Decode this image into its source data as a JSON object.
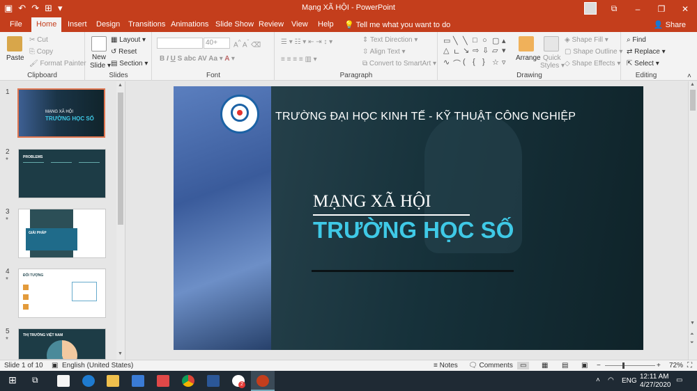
{
  "window": {
    "title": "Mạng XÃ HỘI  -  PowerPoint"
  },
  "tabs": [
    {
      "label": "File"
    },
    {
      "label": "Home"
    },
    {
      "label": "Insert"
    },
    {
      "label": "Design"
    },
    {
      "label": "Transitions"
    },
    {
      "label": "Animations"
    },
    {
      "label": "Slide Show"
    },
    {
      "label": "Review"
    },
    {
      "label": "View"
    },
    {
      "label": "Help"
    }
  ],
  "tell_me": "Tell me what you want to do",
  "share": "Share",
  "ribbon": {
    "clipboard": {
      "label": "Clipboard",
      "paste": "Paste",
      "cut": "Cut",
      "copy": "Copy",
      "format_painter": "Format Painter"
    },
    "slides": {
      "label": "Slides",
      "new_slide_1": "New",
      "new_slide_2": "Slide ▾",
      "layout": "Layout ▾",
      "reset": "Reset",
      "section": "Section ▾"
    },
    "font": {
      "label": "Font",
      "font_size": "40+"
    },
    "paragraph": {
      "label": "Paragraph",
      "text_direction": "Text Direction ▾",
      "align_text": "Align Text ▾",
      "convert_smartart": "Convert to SmartArt ▾"
    },
    "drawing": {
      "label": "Drawing",
      "arrange": "Arrange",
      "quick_styles_1": "Quick",
      "quick_styles_2": "Styles ▾",
      "shape_fill": "Shape Fill ▾",
      "shape_outline": "Shape Outline ▾",
      "shape_effects": "Shape Effects ▾"
    },
    "editing": {
      "label": "Editing",
      "find": "Find",
      "replace": "Replace ▾",
      "select": "Select ▾"
    }
  },
  "thumbnails": [
    {
      "num": "1",
      "star": ""
    },
    {
      "num": "2",
      "star": "*"
    },
    {
      "num": "3",
      "star": "*"
    },
    {
      "num": "4",
      "star": "*"
    },
    {
      "num": "5",
      "star": "*"
    }
  ],
  "thumb_text": {
    "t1_title": "MẠNG XÃ HỘI",
    "t1_sub": "TRƯỜNG HỌC SỐ",
    "t2_title": "PROBLEMS",
    "t3_title": "GIẢI PHÁP",
    "t4_title": "ĐỐI TƯỢNG",
    "t5_title": "THỊ TRƯỜNG VIỆT NAM"
  },
  "slide": {
    "university": "TRƯỜNG ĐẠI HỌC KINH TẾ - KỸ THUẬT CÔNG NGHIỆP",
    "title": "MẠNG XÃ HỘI",
    "subtitle": "TRƯỜNG HỌC SỐ"
  },
  "status": {
    "slide_of": "Slide 1 of 10",
    "language": "English (United States)",
    "notes": "Notes",
    "comments": "Comments",
    "zoom": "72%"
  },
  "taskbar": {
    "lang": "ENG",
    "time": "12:11 AM",
    "date": "4/27/2020",
    "badge": "2"
  },
  "colors": {
    "accent": "#c43e1c",
    "slide_cyan": "#3fc9e6",
    "taskbar": "#1f2a34"
  }
}
